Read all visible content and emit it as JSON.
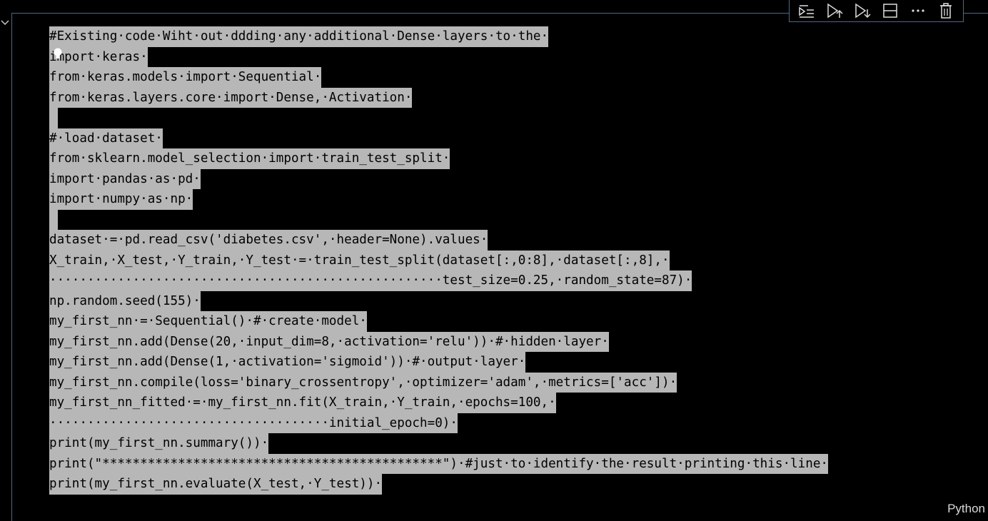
{
  "cell": {
    "language": "Python",
    "lines": [
      "#Existing·code·Wiht·out·ddding·any·additional·Dense·layers·to·the·",
      "import·keras·",
      "from·keras.models·import·Sequential·",
      "from·keras.layers.core·import·Dense,·Activation·",
      "",
      "#·load·dataset·",
      "from·sklearn.model_selection·import·train_test_split·",
      "import·pandas·as·pd·",
      "import·numpy·as·np·",
      "",
      "dataset·=·pd.read_csv('diabetes.csv',·header=None).values·",
      "X_train,·X_test,·Y_train,·Y_test·=·train_test_split(dataset[:,0:8],·dataset[:,8],·",
      "····················································test_size=0.25,·random_state=87)·",
      "np.random.seed(155)·",
      "my_first_nn·=·Sequential()·#·create·model·",
      "my_first_nn.add(Dense(20,·input_dim=8,·activation='relu'))·#·hidden·layer·",
      "my_first_nn.add(Dense(1,·activation='sigmoid'))·#·output·layer·",
      "my_first_nn.compile(loss='binary_crossentropy',·optimizer='adam',·metrics=['acc'])·",
      "my_first_nn_fitted·=·my_first_nn.fit(X_train,·Y_train,·epochs=100,·",
      "·····································initial_epoch=0)·",
      "print(my_first_nn.summary())·",
      "print(\"*********************************************\")·#just·to·identify·the·result·printing·this·line·",
      "print(my_first_nn.evaluate(X_test,·Y_test))·"
    ]
  },
  "toolbar": {
    "icons": [
      "execute-above-icon",
      "run-by-line-icon",
      "execute-below-icon",
      "split-cell-icon",
      "more-actions-icon",
      "delete-cell-icon"
    ]
  },
  "colors": {
    "selection": "#b7b7b7",
    "border": "#3a6ea5",
    "background": "#000000"
  }
}
